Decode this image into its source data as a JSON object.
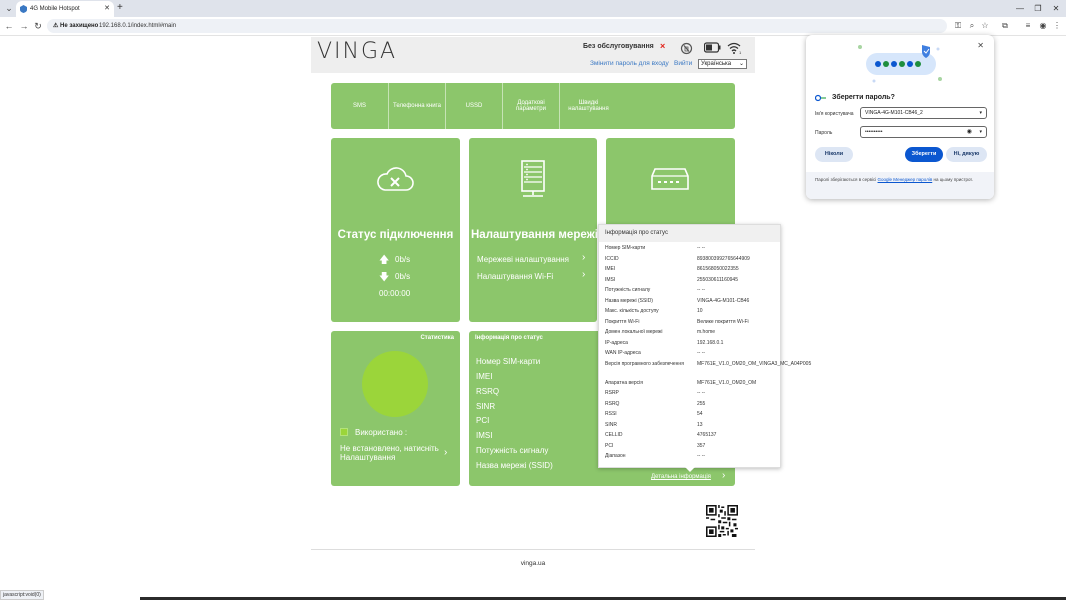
{
  "browser": {
    "tab_title": "4G Mobile Hotspot",
    "tab_close": "✕",
    "new_tab": "+",
    "security_label": "⚠ Не захищено",
    "url": "192.168.0.1/index.html#main",
    "status_text": "javascript:void(0)"
  },
  "header": {
    "logo": "VINGA",
    "no_service": "Без обслуговування",
    "no_service_mark": "×",
    "change_password": "Змінити пароль для входу",
    "logout": "Вийти",
    "language": "Українська"
  },
  "nav": {
    "items": [
      {
        "label": "SMS"
      },
      {
        "label": "Телефонна книга"
      },
      {
        "label": "USSD"
      },
      {
        "label": "Додаткові параметри"
      },
      {
        "label": "Швидкі налаштування"
      }
    ]
  },
  "tiles": {
    "connection": {
      "title": "Статус підключення",
      "upload": "0b/s",
      "download": "0b/s",
      "time": "00:00:00"
    },
    "network": {
      "title": "Налаштування мережі",
      "link1": "Мережеві налаштування",
      "link2": "Налаштування Wi-Fi"
    },
    "stats": {
      "heading": "Статистика",
      "used": "Використано   :",
      "not_set": "Не встановлено, натисніть Налаштування"
    },
    "status_info": {
      "heading": "Інформація про статус",
      "items": [
        "Номер SIM-карти",
        "IMEI",
        "RSRQ",
        "SINR",
        "PCI",
        "IMSI",
        "Потужність сигналу",
        "Назва мережі (SSID)"
      ],
      "detail_link": "Детальна інформація"
    }
  },
  "popup": {
    "title": "Інформація про статус",
    "rows": [
      {
        "k": "Номер SIM-карти",
        "v": "-- --"
      },
      {
        "k": "ICCID",
        "v": "8938003992765644909"
      },
      {
        "k": "IMEI",
        "v": "861568050022355"
      },
      {
        "k": "IMSI",
        "v": "255030611160945"
      },
      {
        "k": "Потужність сигналу",
        "v": "-- --"
      },
      {
        "k": "Назва мережі (SSID)",
        "v": "VINGA-4G-M101-CB46"
      },
      {
        "k": "Макс. кількість доступу",
        "v": "10"
      },
      {
        "k": "Покриття Wi-Fi",
        "v": "Велике покриття Wi-Fi"
      },
      {
        "k": "Домен локальної мережі",
        "v": "m.home"
      },
      {
        "k": "IP-адреса",
        "v": "192.168.0.1"
      },
      {
        "k": "WAN IP-адреса",
        "v": "-- --"
      },
      {
        "k": "Версія програмного забезпечення",
        "v": "MF761E_V1.0_OM20_OM_VINGA3_MC_A04P005"
      },
      {
        "k": "Апаратна версія",
        "v": "MF761E_V1.0_OM20_OM"
      },
      {
        "k": "RSRP",
        "v": "-- --"
      },
      {
        "k": "RSRQ",
        "v": "255"
      },
      {
        "k": "RSSI",
        "v": "54"
      },
      {
        "k": "SINR",
        "v": "13"
      },
      {
        "k": "CELLID",
        "v": "4765137"
      },
      {
        "k": "PCI",
        "v": "357"
      },
      {
        "k": "Діапазон",
        "v": "-- --"
      }
    ]
  },
  "footer": {
    "text": "vinga.ua"
  },
  "save_password": {
    "title": "Зберегти пароль?",
    "username_label": "Ім'я користувача",
    "username": "VINGA-4G-M101-CB46_2",
    "password_label": "Пароль",
    "password_mask": "••••••••••",
    "never": "Ніколи",
    "save": "Зберегти",
    "no_thanks": "Ні, дякую",
    "note_prefix": "Паролі зберігаються в сервісі ",
    "note_link": "Google Менеджер паролів",
    "note_suffix": " на цьому пристрої."
  },
  "colors": {
    "tile_green": "#8cc66b",
    "circle_green": "#9bd53a",
    "link_blue": "#3a78c3",
    "alert_red": "#e2231a",
    "google_blue": "#0b57d0"
  }
}
